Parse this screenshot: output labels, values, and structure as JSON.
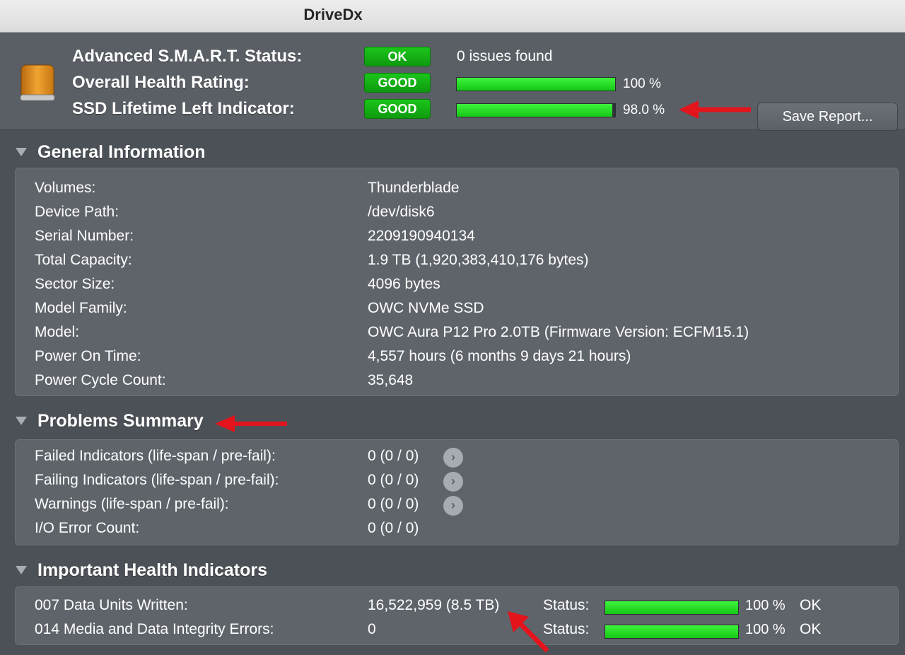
{
  "window": {
    "title": "DriveDx"
  },
  "header": {
    "smart_status": {
      "label": "Advanced S.M.A.R.T. Status:",
      "badge": "OK",
      "info": "0 issues found"
    },
    "health_rating": {
      "label": "Overall Health Rating:",
      "badge": "GOOD",
      "percent": 100,
      "percent_text": "100 %"
    },
    "ssd_lifetime": {
      "label": "SSD Lifetime Left Indicator:",
      "badge": "GOOD",
      "percent": 98.0,
      "percent_text": "98.0 %"
    },
    "save_report": "Save Report..."
  },
  "general": {
    "title": "General Information",
    "rows": [
      {
        "key": "Volumes:",
        "value": "Thunderblade"
      },
      {
        "key": "Device Path:",
        "value": "/dev/disk6"
      },
      {
        "key": "Serial Number:",
        "value": "2209190940134"
      },
      {
        "key": "Total Capacity:",
        "value": "1.9 TB (1,920,383,410,176 bytes)"
      },
      {
        "key": "Sector Size:",
        "value": "4096 bytes"
      },
      {
        "key": "Model Family:",
        "value": "OWC NVMe SSD"
      },
      {
        "key": "Model:",
        "value": "OWC Aura P12 Pro 2.0TB  (Firmware Version: ECFM15.1)"
      },
      {
        "key": "Power On Time:",
        "value": "4,557 hours (6 months 9 days 21 hours)"
      },
      {
        "key": "Power Cycle Count:",
        "value": "35,648"
      }
    ]
  },
  "problems": {
    "title": "Problems Summary",
    "rows": [
      {
        "key": "Failed Indicators (life-span / pre-fail):",
        "value": "0  (0 / 0)"
      },
      {
        "key": "Failing Indicators (life-span / pre-fail):",
        "value": "0  (0 / 0)"
      },
      {
        "key": "Warnings (life-span / pre-fail):",
        "value": "0  (0 / 0)"
      },
      {
        "key": "I/O Error Count:",
        "value": "0  (0 / 0)"
      }
    ],
    "go_glyph": "›"
  },
  "indicators": {
    "title": "Important Health Indicators",
    "status_label": "Status:",
    "rows": [
      {
        "key": "007  Data Units Written:",
        "value": "16,522,959 (8.5 TB)",
        "percent": 100,
        "percent_text": "100 %",
        "status": "OK"
      },
      {
        "key": "014  Media and Data Integrity Errors:",
        "value": "0",
        "percent": 100,
        "percent_text": "100 %",
        "status": "OK"
      }
    ]
  },
  "colors": {
    "background": "#4c5157",
    "panel": "#5f646b",
    "good": "#16c816",
    "arrow": "#e3141c"
  },
  "icons": {
    "drive": "external-drive-icon",
    "expand": "disclosure-triangle-icon",
    "details": "chevron-right-circle-icon"
  }
}
